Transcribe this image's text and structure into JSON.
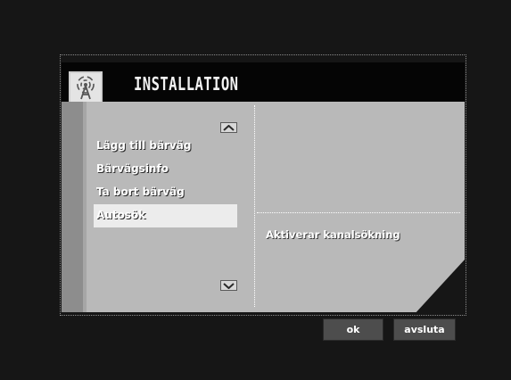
{
  "window": {
    "title": "INSTALLATION",
    "title_icon": "antenna-icon"
  },
  "menu": {
    "scroll_up_icon": "chevron-up-icon",
    "scroll_down_icon": "chevron-down-icon",
    "items": [
      {
        "label": "Lägg till bärväg",
        "selected": false
      },
      {
        "label": "Bärvägsinfo",
        "selected": false
      },
      {
        "label": "Ta bort bärväg",
        "selected": false
      },
      {
        "label": "Autosök",
        "selected": true
      }
    ]
  },
  "info": {
    "description": "Aktiverar kanalsökning"
  },
  "buttons": {
    "ok_label": "ok",
    "quit_label": "avsluta"
  },
  "colors": {
    "panel": "#b9b9b9",
    "title_bar": "#050505",
    "selection": "#ececec",
    "button": "#4d4d4d"
  }
}
